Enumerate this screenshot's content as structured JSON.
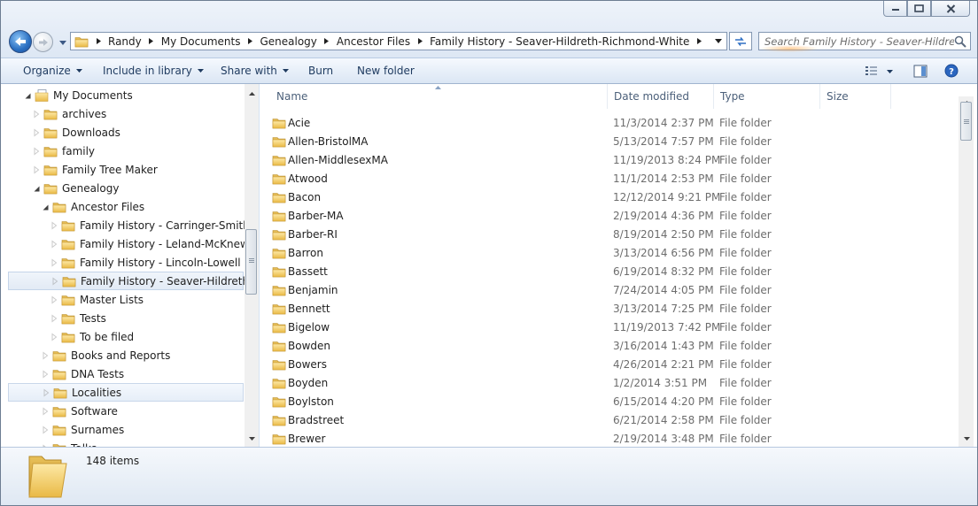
{
  "window": {
    "minimize_label": "Minimize",
    "maximize_label": "Maximize",
    "close_label": "Close"
  },
  "address": {
    "crumbs": [
      "Randy",
      "My Documents",
      "Genealogy",
      "Ancestor Files",
      "Family History - Seaver-Hildreth-Richmond-White"
    ]
  },
  "search": {
    "placeholder": "Search Family History - Seaver-Hildreth-Richmond-White"
  },
  "toolbar": {
    "organize": "Organize",
    "include_in_library": "Include in library",
    "share_with": "Share with",
    "burn": "Burn",
    "new_folder": "New folder"
  },
  "nav_tree": [
    {
      "label": "My Documents",
      "level": 0,
      "expanded": true,
      "icon": "documents-library-icon"
    },
    {
      "label": "archives",
      "level": 1,
      "expanded": false,
      "icon": "folder-icon"
    },
    {
      "label": "Downloads",
      "level": 1,
      "expanded": false,
      "icon": "folder-icon"
    },
    {
      "label": "family",
      "level": 1,
      "expanded": false,
      "icon": "folder-icon"
    },
    {
      "label": "Family Tree Maker",
      "level": 1,
      "expanded": false,
      "icon": "folder-icon"
    },
    {
      "label": "Genealogy",
      "level": 1,
      "expanded": true,
      "icon": "folder-icon"
    },
    {
      "label": "Ancestor Files",
      "level": 2,
      "expanded": true,
      "icon": "folder-icon"
    },
    {
      "label": "Family History - Carringer-Smith-Auble-Kemp",
      "level": 3,
      "expanded": false,
      "icon": "folder-icon"
    },
    {
      "label": "Family History - Leland-McKnew",
      "level": 3,
      "expanded": false,
      "icon": "folder-icon"
    },
    {
      "label": "Family History - Lincoln-Lowell",
      "level": 3,
      "expanded": false,
      "icon": "folder-icon"
    },
    {
      "label": "Family History - Seaver-Hildreth-Richmond-White",
      "level": 3,
      "expanded": false,
      "icon": "folder-icon",
      "selected": true
    },
    {
      "label": "Master Lists",
      "level": 3,
      "expanded": false,
      "icon": "folder-icon"
    },
    {
      "label": "Tests",
      "level": 3,
      "expanded": false,
      "icon": "folder-icon"
    },
    {
      "label": "To be filed",
      "level": 3,
      "expanded": false,
      "icon": "folder-icon"
    },
    {
      "label": "Books and Reports",
      "level": 2,
      "expanded": false,
      "icon": "folder-icon"
    },
    {
      "label": "DNA Tests",
      "level": 2,
      "expanded": false,
      "icon": "folder-icon"
    },
    {
      "label": "Localities",
      "level": 2,
      "expanded": false,
      "icon": "folder-icon",
      "hover": true
    },
    {
      "label": "Software",
      "level": 2,
      "expanded": false,
      "icon": "folder-icon"
    },
    {
      "label": "Surnames",
      "level": 2,
      "expanded": false,
      "icon": "folder-icon"
    },
    {
      "label": "Talks",
      "level": 2,
      "expanded": false,
      "icon": "folder-icon"
    }
  ],
  "columns": {
    "name": "Name",
    "date_modified": "Date modified",
    "type": "Type",
    "size": "Size"
  },
  "files": [
    {
      "name": "Acie",
      "date": "11/3/2014 2:37 PM",
      "type": "File folder"
    },
    {
      "name": "Allen-BristolMA",
      "date": "5/13/2014 7:57 PM",
      "type": "File folder"
    },
    {
      "name": "Allen-MiddlesexMA",
      "date": "11/19/2013 8:24 PM",
      "type": "File folder"
    },
    {
      "name": "Atwood",
      "date": "11/1/2014 2:53 PM",
      "type": "File folder"
    },
    {
      "name": "Bacon",
      "date": "12/12/2014 9:21 PM",
      "type": "File folder"
    },
    {
      "name": "Barber-MA",
      "date": "2/19/2014 4:36 PM",
      "type": "File folder"
    },
    {
      "name": "Barber-RI",
      "date": "8/19/2014 2:50 PM",
      "type": "File folder"
    },
    {
      "name": "Barron",
      "date": "3/13/2014 6:56 PM",
      "type": "File folder"
    },
    {
      "name": "Bassett",
      "date": "6/19/2014 8:32 PM",
      "type": "File folder"
    },
    {
      "name": "Benjamin",
      "date": "7/24/2014 4:05 PM",
      "type": "File folder"
    },
    {
      "name": "Bennett",
      "date": "3/13/2014 7:25 PM",
      "type": "File folder"
    },
    {
      "name": "Bigelow",
      "date": "11/19/2013 7:42 PM",
      "type": "File folder"
    },
    {
      "name": "Bowden",
      "date": "3/16/2014 1:43 PM",
      "type": "File folder"
    },
    {
      "name": "Bowers",
      "date": "4/26/2014 2:21 PM",
      "type": "File folder"
    },
    {
      "name": "Boyden",
      "date": "1/2/2014 3:51 PM",
      "type": "File folder"
    },
    {
      "name": "Boylston",
      "date": "6/15/2014 4:20 PM",
      "type": "File folder"
    },
    {
      "name": "Bradstreet",
      "date": "6/21/2014 2:58 PM",
      "type": "File folder"
    },
    {
      "name": "Brewer",
      "date": "2/19/2014 3:48 PM",
      "type": "File folder"
    }
  ],
  "details": {
    "item_count": "148 items"
  }
}
